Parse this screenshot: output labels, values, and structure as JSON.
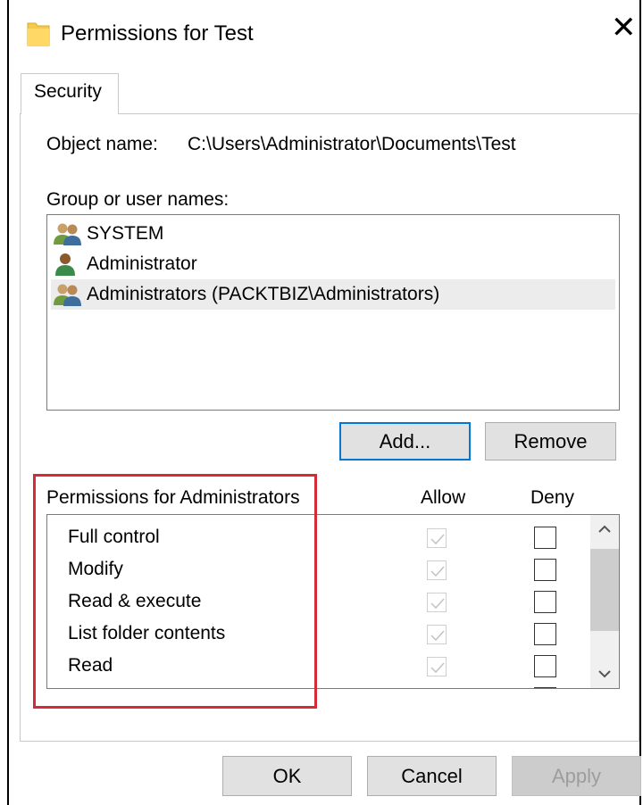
{
  "window": {
    "title": "Permissions for Test",
    "close_glyph": "✕"
  },
  "tabs": [
    {
      "label": "Security"
    }
  ],
  "object": {
    "label": "Object name:",
    "value": "C:\\Users\\Administrator\\Documents\\Test"
  },
  "group": {
    "label": "Group or user names:",
    "users": [
      {
        "name": "SYSTEM",
        "icon": "group-icon"
      },
      {
        "name": "Administrator",
        "icon": "user-icon"
      },
      {
        "name": "Administrators (PACKTBIZ\\Administrators)",
        "icon": "group-icon",
        "selected": true
      }
    ]
  },
  "buttons": {
    "add": "Add...",
    "remove": "Remove",
    "ok": "OK",
    "cancel": "Cancel",
    "apply": "Apply"
  },
  "permissions": {
    "header": "Permissions for Administrators",
    "allow_label": "Allow",
    "deny_label": "Deny",
    "rows": [
      {
        "name": "Full control",
        "allow": true,
        "deny": false
      },
      {
        "name": "Modify",
        "allow": true,
        "deny": false
      },
      {
        "name": "Read & execute",
        "allow": true,
        "deny": false
      },
      {
        "name": "List folder contents",
        "allow": true,
        "deny": false
      },
      {
        "name": "Read",
        "allow": true,
        "deny": false
      }
    ]
  },
  "colors": {
    "highlight": "#d62b37",
    "focus_border": "#0078d7",
    "folder": "#f5c94a"
  }
}
